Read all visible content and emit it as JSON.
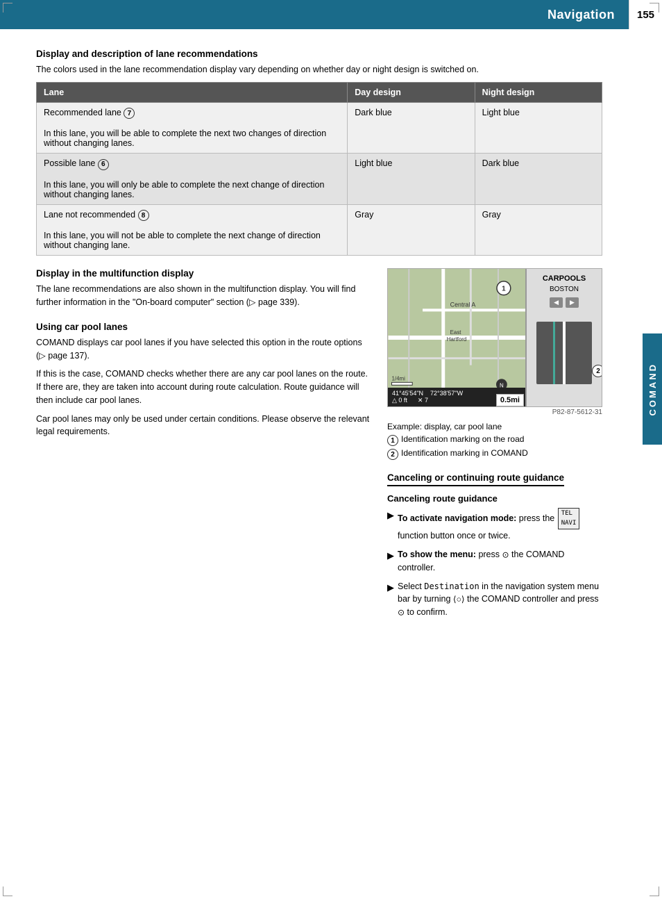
{
  "header": {
    "title": "Navigation",
    "page_number": "155"
  },
  "side_tab": {
    "label": "COMAND"
  },
  "sections": {
    "display_description": {
      "heading": "Display and description of lane recommendations",
      "intro": "The colors used in the lane recommendation display vary depending on whether day or night design is switched on."
    },
    "table": {
      "headers": [
        "Lane",
        "Day design",
        "Night design"
      ],
      "rows": [
        {
          "lane": "Recommended lane ⑦\nIn this lane, you will be able to complete the next two changes of direction without changing lanes.",
          "day": "Dark blue",
          "night": "Light blue"
        },
        {
          "lane": "Possible lane ⑥\nIn this lane, you will only be able to complete the next change of direction without changing lanes.",
          "day": "Light blue",
          "night": "Dark blue"
        },
        {
          "lane": "Lane not recommended ⑧\nIn this lane, you will not be able to complete the next change of direction without changing lane.",
          "day": "Gray",
          "night": "Gray"
        }
      ]
    },
    "multifunction": {
      "heading": "Display in the multifunction display",
      "text": "The lane recommendations are also shown in the multifunction display. You will find further information in the \"On-board computer\" section (▷ page 339)."
    },
    "carpool": {
      "heading": "Using car pool lanes",
      "para1": "COMAND displays car pool lanes if you have selected this option in the route options (▷ page 137).",
      "para2": "If this is the case, COMAND checks whether there are any car pool lanes on the route. If there are, they are taken into account during route calculation. Route guidance will then include car pool lanes.",
      "para3": "Car pool lanes may only be used under certain conditions. Please observe the relevant legal requirements."
    },
    "map": {
      "caption": "Example: display, car pool lane",
      "legend": [
        {
          "num": "1",
          "text": "Identification marking on the road"
        },
        {
          "num": "2",
          "text": "Identification marking in COMAND"
        }
      ],
      "photo_ref": "P82-87-5612-31",
      "carpools_label": "CARPOOLS",
      "carpools_sub": "BOSTON",
      "distance": "0.5mi",
      "coords": "41°45'54\"N  72°38'57\"W\n△ 0 ft         × 7"
    },
    "canceling": {
      "heading": "Canceling or continuing route guidance",
      "sub_heading": "Canceling route guidance",
      "bullets": [
        {
          "bold_part": "To activate navigation mode:",
          "rest": " press the TEL/NAVI function button once or twice."
        },
        {
          "bold_part": "To show the menu:",
          "rest": " press ⊙ the COMAND controller."
        },
        {
          "bold_part": "",
          "rest": "Select Destination in the navigation system menu bar by turning ⟨○⟩ the COMAND controller and press ⊙ to confirm."
        }
      ]
    }
  }
}
